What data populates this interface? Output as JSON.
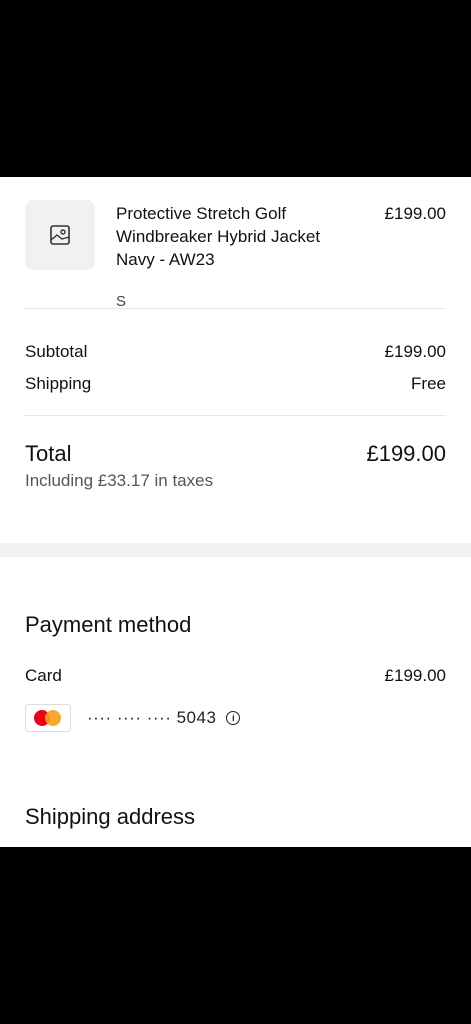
{
  "order_item": {
    "image_icon": "image-placeholder-icon",
    "title": "Protective Stretch Golf Windbreaker Hybrid Jacket Navy - AW23",
    "variant": "S",
    "price": "£199.00"
  },
  "summary": {
    "subtotal_label": "Subtotal",
    "subtotal_value": "£199.00",
    "shipping_label": "Shipping",
    "shipping_value": "Free",
    "total_label": "Total",
    "total_value": "£199.00",
    "tax_note": "Including £33.17 in taxes"
  },
  "payment": {
    "title": "Payment method",
    "method_label": "Card",
    "amount": "£199.00",
    "card_brand_icon": "mastercard-icon",
    "masked_number": "···· ···· ···· 5043",
    "info_icon": "info-icon",
    "info_glyph": "i"
  },
  "shipping_address": {
    "title": "Shipping address"
  },
  "colors": {
    "background": "#ffffff",
    "band": "#f1f2f4",
    "divider": "#e6e6e6",
    "mastercard_red": "#eb001b",
    "mastercard_orange": "#f79e1b"
  }
}
